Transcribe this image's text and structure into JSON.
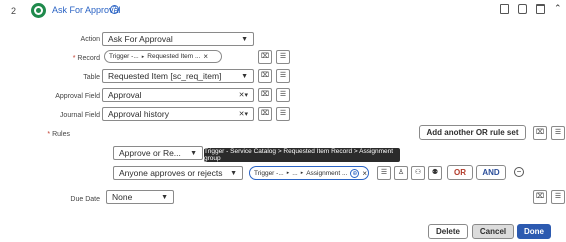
{
  "step": {
    "number": "2",
    "title": "Ask For Approval",
    "help_icon": "help-circle-icon"
  },
  "header_icons": [
    "copy-icon",
    "delete-step-icon",
    "trash-icon",
    "collapse-icon"
  ],
  "fields": {
    "action": {
      "label": "Action",
      "value": "Ask For Approval"
    },
    "record": {
      "label": "Record",
      "pill_parts": [
        "Trigger -...",
        "Requested Item ..."
      ]
    },
    "table": {
      "label": "Table",
      "value": "Requested Item [sc_req_item]"
    },
    "approval_field": {
      "label": "Approval Field",
      "value": "Approval"
    },
    "journal_field": {
      "label": "Journal Field",
      "value": "Approval history"
    },
    "rules": {
      "label": "Rules"
    },
    "due_date": {
      "label": "Due Date",
      "value": "None"
    }
  },
  "rules_section": {
    "add_or_rule_set": "Add another OR rule set",
    "rule_type": "Approve or Re...",
    "approver_condition": "Anyone approves or rejects",
    "approver_pill_parts": [
      "Trigger -...",
      "...",
      "Assignment ..."
    ],
    "tooltip": "Trigger - Service Catalog > Requested Item Record > Assignment group",
    "or_label": "OR",
    "and_label": "AND"
  },
  "footer": {
    "delete": "Delete",
    "cancel": "Cancel",
    "done": "Done"
  },
  "colors": {
    "done_bg": "#2c5ab0",
    "cancel_bg": "#dcdcdc",
    "pill_border": "#2a63c4",
    "tooltip_bg": "#2b2b2b"
  }
}
